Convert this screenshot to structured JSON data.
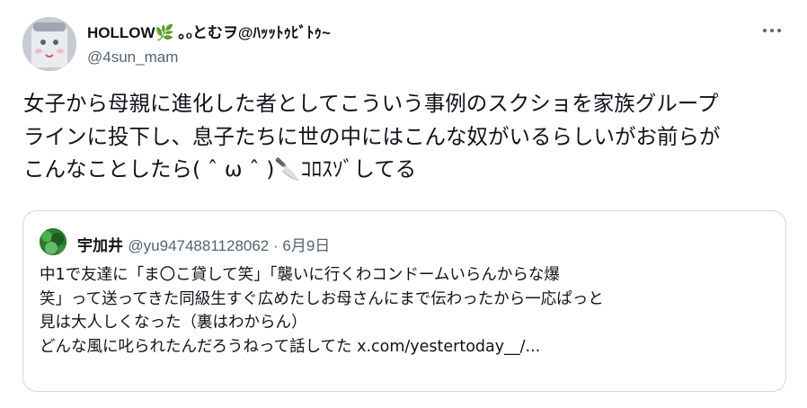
{
  "author": {
    "display_name": "HOLLOW🌿 ｡ₒとむヲ@ﾊｯｯﾄｩﾋﾞﾄｩ~",
    "handle": "@4sun_mam"
  },
  "tweet": {
    "text": "女子から母親に進化した者としてこういう事例のスクショを家族グループ\nラインに投下し、息子たちに世の中にはこんな奴がいるらしいがお前らが\nこんなことしたら( ˆ ω ˆ )🔪ｺﾛｽｿﾞしてる"
  },
  "quoted": {
    "name": "宇加井",
    "handle": "@yu9474881128062",
    "separator": " · ",
    "date": "6月9日",
    "text": "中1で友達に「ま〇こ貸して笑」「襲いに行くわコンドームいらんからな爆\n笑」って送ってきた同級生すぐ広めたしお母さんにまで伝わったから一応ぱっと\n見は大人しくなった（裏はわからん）\nどんな風に叱られたんだろうねって話してた x.com/yestertoday__/..."
  },
  "icons": {
    "more": "more-horizontal-icon"
  }
}
